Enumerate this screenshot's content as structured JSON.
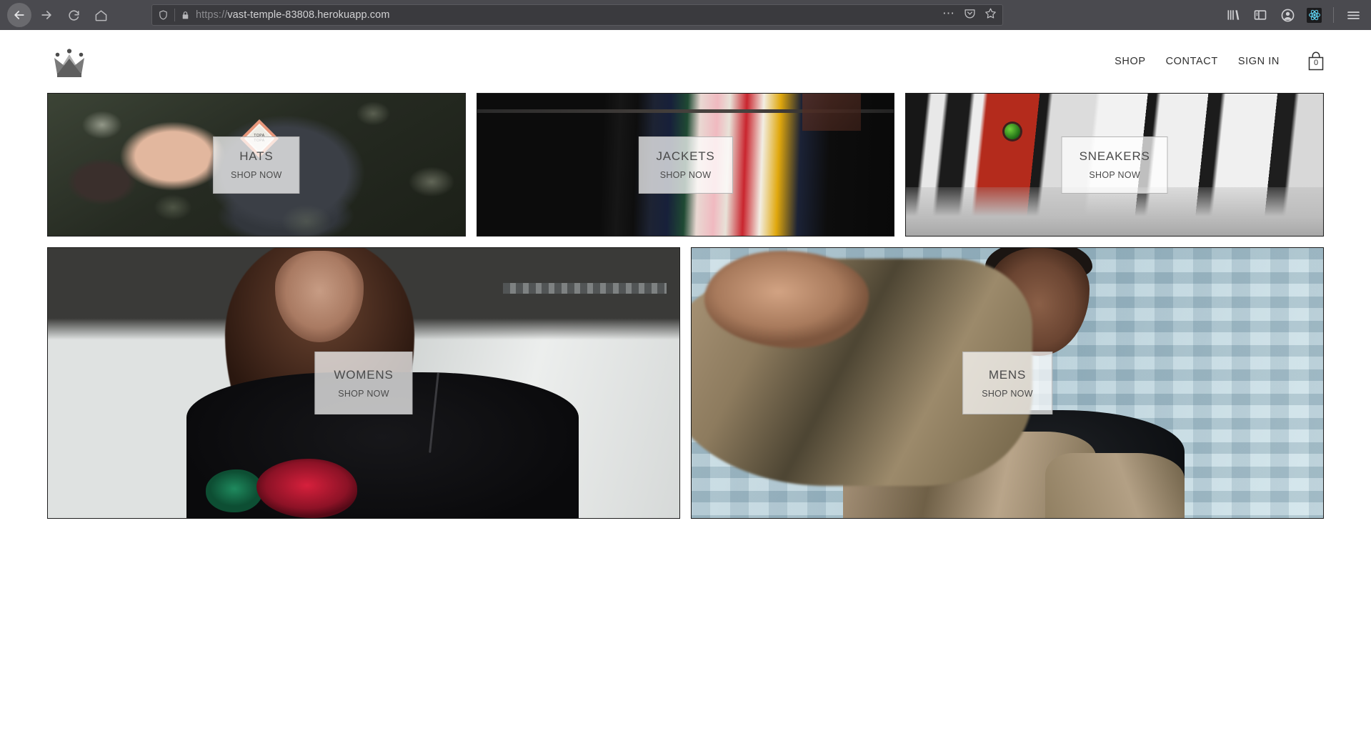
{
  "browser": {
    "back_icon": "back-arrow-icon",
    "forward_icon": "forward-arrow-icon",
    "reload_icon": "reload-icon",
    "home_icon": "home-icon",
    "shield_icon": "shield-icon",
    "lock_icon": "padlock-icon",
    "url_scheme": "https://",
    "url_host": "vast-temple-83808.herokuapp.com",
    "page_actions_icon": "ellipsis-icon",
    "pocket_icon": "pocket-icon",
    "bookmark_icon": "star-icon",
    "library_icon": "library-icon",
    "sidebar_icon": "sidebar-icon",
    "account_icon": "account-icon",
    "extension_icon": "react-devtools-icon",
    "menu_icon": "hamburger-menu-icon"
  },
  "site": {
    "logo_icon": "crown-logo-icon",
    "nav": [
      {
        "label": "SHOP",
        "name": "nav-link-shop"
      },
      {
        "label": "CONTACT",
        "name": "nav-link-contact"
      },
      {
        "label": "SIGN IN",
        "name": "nav-link-sign-in"
      }
    ],
    "cart": {
      "icon": "shopping-bag-icon",
      "count": "0"
    }
  },
  "directory": {
    "rows": [
      {
        "items": [
          {
            "title": "HATS",
            "subtitle": "SHOP NOW",
            "name": "directory-item-hats"
          },
          {
            "title": "JACKETS",
            "subtitle": "SHOP NOW",
            "name": "directory-item-jackets"
          },
          {
            "title": "SNEAKERS",
            "subtitle": "SHOP NOW",
            "name": "directory-item-sneakers"
          }
        ]
      },
      {
        "items": [
          {
            "title": "WOMENS",
            "subtitle": "SHOP NOW",
            "name": "directory-item-womens"
          },
          {
            "title": "MENS",
            "subtitle": "SHOP NOW",
            "name": "directory-item-mens"
          }
        ]
      }
    ],
    "hats_patch_text": "TOPA TOPA"
  },
  "colors": {
    "chrome_bg": "#4a4a4f",
    "urlbar_bg": "#3a3a3e",
    "page_bg": "#ffffff",
    "text": "#2f2f2f",
    "overlay_text": "#4a4a4a",
    "tile_border": "#1d1d1d"
  }
}
